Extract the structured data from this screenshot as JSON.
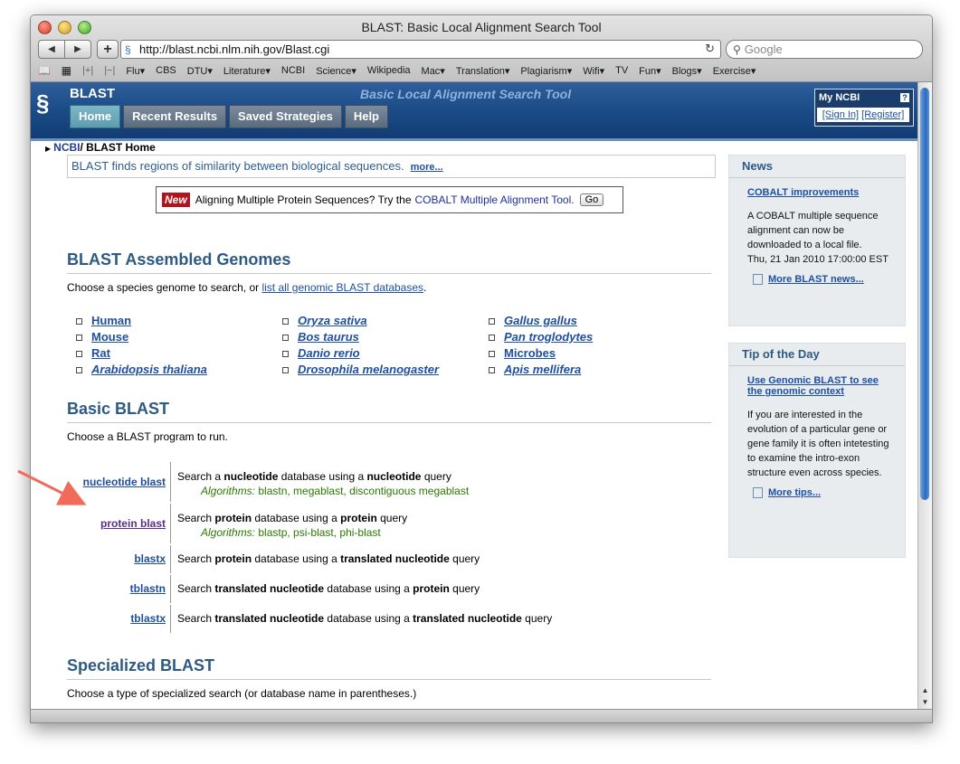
{
  "browser": {
    "window_title": "BLAST: Basic Local Alignment Search Tool",
    "url": "http://blast.ncbi.nlm.nih.gov/Blast.cgi",
    "search_placeholder": "Google",
    "bookmarks": [
      "Flu▾",
      "CBS",
      "DTU▾",
      "Literature▾",
      "NCBI",
      "Science▾",
      "Wikipedia",
      "Mac▾",
      "Translation▾",
      "Plagiarism▾",
      "Wifi▾",
      "TV",
      "Fun▾",
      "Blogs▾",
      "Exercise▾"
    ]
  },
  "header": {
    "brand": "BLAST",
    "tagline": "Basic Local Alignment Search Tool",
    "tabs": [
      "Home",
      "Recent Results",
      "Saved Strategies",
      "Help"
    ],
    "myncbi_title": "My NCBI",
    "myncbi_help": "?",
    "sign_in": "[Sign In]",
    "register": "[Register]"
  },
  "breadcrumb": {
    "root": "NCBI",
    "sep": "/",
    "current": " BLAST Home"
  },
  "intro": {
    "text": "BLAST finds regions of similarity between biological sequences.",
    "more": "more..."
  },
  "promo": {
    "badge": "New",
    "text": "Aligning Multiple Protein Sequences? Try the ",
    "link": "COBALT Multiple Alignment Tool.",
    "go": "Go"
  },
  "assembled": {
    "title": "BLAST Assembled Genomes",
    "desc_prefix": "Choose a species genome to search, or ",
    "desc_link": "list all genomic BLAST databases",
    "desc_suffix": ".",
    "col1": [
      "Human",
      "Mouse",
      "Rat",
      "Arabidopsis thaliana"
    ],
    "col2": [
      "Oryza sativa",
      "Bos taurus",
      "Danio rerio",
      "Drosophila melanogaster"
    ],
    "col3": [
      "Gallus gallus",
      "Pan troglodytes",
      "Microbes",
      "Apis mellifera"
    ]
  },
  "basic": {
    "title": "Basic BLAST",
    "desc": "Choose a BLAST program to run.",
    "programs": [
      {
        "name": "nucleotide blast",
        "d1": "Search a ",
        "b1": "nucleotide",
        "d2": " database using a ",
        "b2": "nucleotide",
        "d3": " query",
        "algo_label": "Algorithms:",
        "algo": " blastn, megablast, discontiguous megablast"
      },
      {
        "name": "protein blast",
        "d1": "Search ",
        "b1": "protein",
        "d2": " database using a ",
        "b2": "protein",
        "d3": " query",
        "algo_label": "Algorithms:",
        "algo": " blastp, psi-blast, phi-blast"
      },
      {
        "name": "blastx",
        "d1": "Search ",
        "b1": "protein",
        "d2": " database using a ",
        "b2": "translated nucleotide",
        "d3": " query"
      },
      {
        "name": "tblastn",
        "d1": "Search ",
        "b1": "translated nucleotide",
        "d2": " database using a ",
        "b2": "protein",
        "d3": " query"
      },
      {
        "name": "tblastx",
        "d1": "Search ",
        "b1": "translated nucleotide",
        "d2": " database using a ",
        "b2": "translated nucleotide",
        "d3": " query"
      }
    ]
  },
  "specialized": {
    "title": "Specialized BLAST",
    "desc": "Choose a type of specialized search (or database name in parentheses.)"
  },
  "news": {
    "title": "News",
    "headline": "COBALT improvements",
    "body": "A COBALT multiple sequence alignment can now be downloaded to a local file.",
    "date": "Thu, 21 Jan 2010 17:00:00 EST",
    "more": "More BLAST news..."
  },
  "tip": {
    "title": "Tip of the Day",
    "headline": "Use Genomic BLAST to see the genomic context",
    "body": "If you are interested in the evolution of a particular gene or gene family it is often intetesting to examine the intro-exon structure even across species.",
    "more": "More tips..."
  },
  "colors": {
    "ncbi_blue": "#1a4a85",
    "section_title": "#2c5a84",
    "link": "#1e4fa0",
    "algo_green": "#2a7a00",
    "annotation_arrow": "#f26a5a"
  }
}
